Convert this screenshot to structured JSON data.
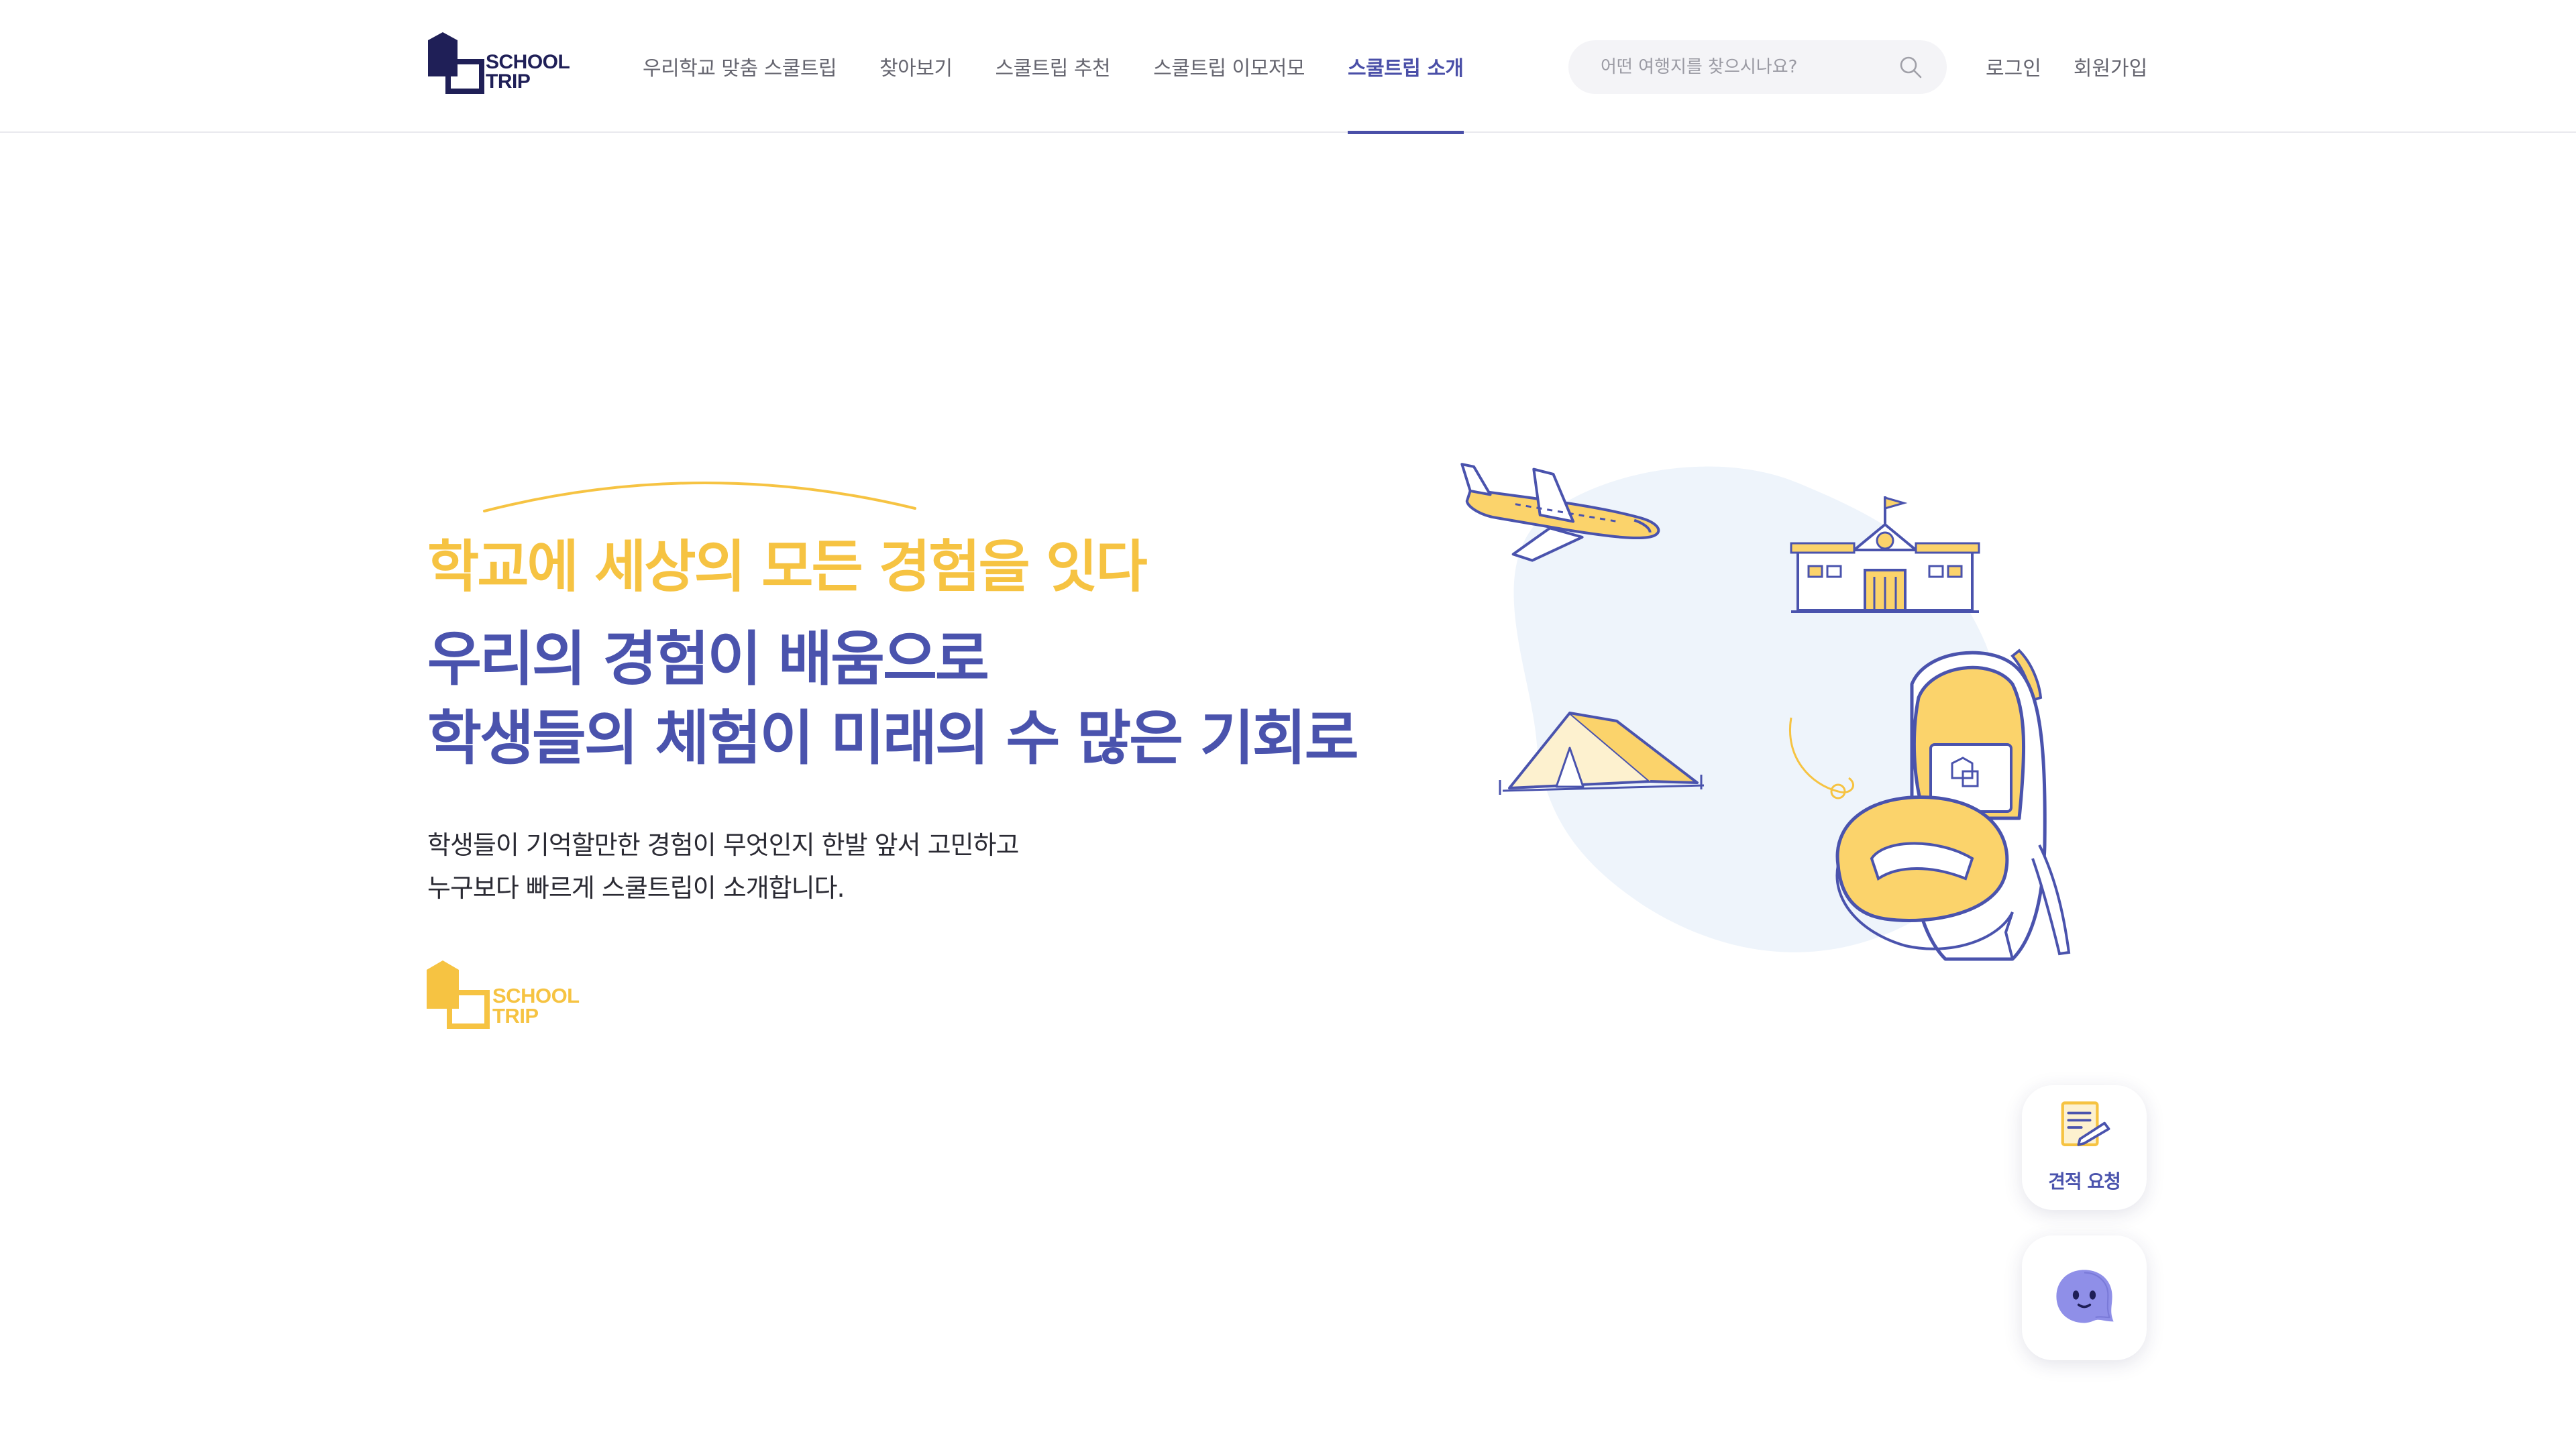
{
  "brand": {
    "logo_line1": "SCHOOL",
    "logo_line2": "TRIP",
    "primary_color": "#1f1f57",
    "accent_color": "#4a53ad",
    "highlight_color": "#f6c342"
  },
  "nav": {
    "items": [
      {
        "label": "우리학교 맞춤 스쿨트립",
        "active": false
      },
      {
        "label": "찾아보기",
        "active": false
      },
      {
        "label": "스쿨트립 추천",
        "active": false
      },
      {
        "label": "스쿨트립 이모저모",
        "active": false
      },
      {
        "label": "스쿨트립 소개",
        "active": true
      }
    ]
  },
  "search": {
    "placeholder": "어떤 여행지를 찾으시나요?",
    "value": "",
    "icon": "search-icon"
  },
  "auth": {
    "login": "로그인",
    "signup": "회원가입"
  },
  "hero": {
    "tagline": "학교에 세상의 모든 경험을 잇다",
    "headline_line1": "우리의 경험이 배움으로",
    "headline_line2": "학생들의 체험이 미래의 수 많은 기회로",
    "desc_line1": "학생들이 기억할만한 경험이 무엇인지 한발 앞서 고민하고",
    "desc_line2": "누구보다 빠르게 스쿨트립이 소개합니다.",
    "logo_line1": "SCHOOL",
    "logo_line2": "TRIP"
  },
  "floating": {
    "quote_label": "견적 요청",
    "quote_icon": "document-pencil-icon",
    "chat_icon": "chat-bot-icon"
  }
}
